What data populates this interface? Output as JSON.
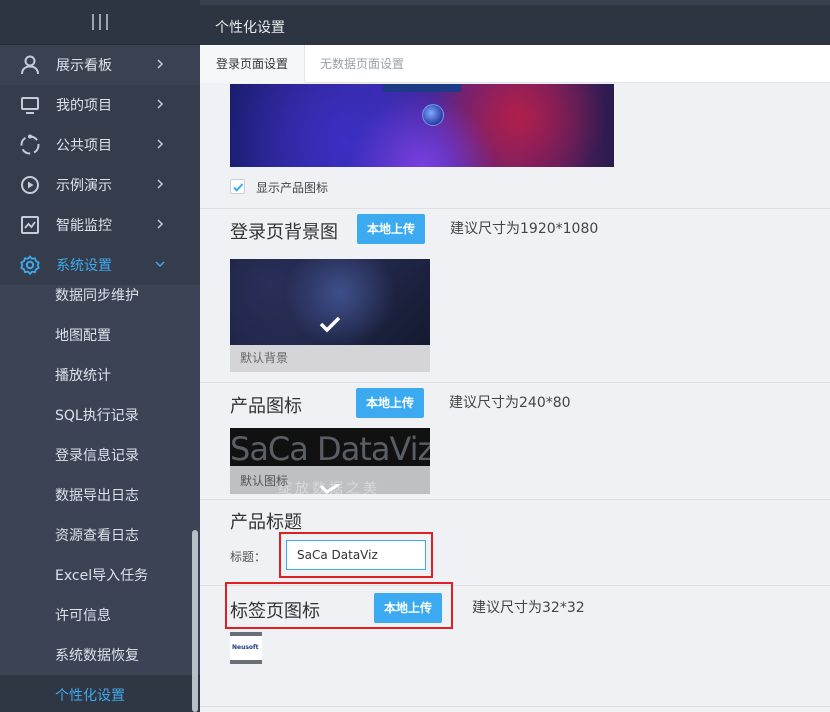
{
  "sidebar": {
    "nav": [
      {
        "label": "展示看板",
        "icon": "user-icon"
      },
      {
        "label": "我的项目",
        "icon": "monitor-icon"
      },
      {
        "label": "公共项目",
        "icon": "circle-dots-icon"
      },
      {
        "label": "示例演示",
        "icon": "play-icon"
      },
      {
        "label": "智能监控",
        "icon": "chart-line-icon"
      },
      {
        "label": "系统设置",
        "icon": "gear-icon"
      }
    ],
    "sub_items": [
      "数据同步维护",
      "地图配置",
      "播放统计",
      "SQL执行记录",
      "登录信息记录",
      "数据导出日志",
      "资源查看日志",
      "Excel导入任务",
      "许可信息",
      "系统数据恢复",
      "个性化设置"
    ],
    "accent_color": "#3fa8ea"
  },
  "header": {
    "title": "个性化设置"
  },
  "tabs": [
    {
      "label": "登录页面设置"
    },
    {
      "label": "无数据页面设置"
    }
  ],
  "login_settings": {
    "show_product_icon_label": "显示产品图标",
    "show_product_icon_checked": true,
    "bg_section": {
      "title": "登录页背景图",
      "upload_label": "本地上传",
      "hint": "建议尺寸为1920*1080",
      "thumb_caption": "默认背景"
    },
    "icon_section": {
      "title": "产品图标",
      "upload_label": "本地上传",
      "hint": "建议尺寸为240*80",
      "thumb_caption": "默认图标",
      "logo_text": "SaCa DataViz",
      "watermark_text": "绽放数据之美"
    },
    "product_title_section": {
      "title": "产品标题",
      "field_label": "标题：",
      "value": "SaCa DataViz"
    },
    "tab_icon_section": {
      "title": "标签页图标",
      "upload_label": "本地上传",
      "hint": "建议尺寸为32*32",
      "favicon_text": "Neusoft"
    }
  }
}
